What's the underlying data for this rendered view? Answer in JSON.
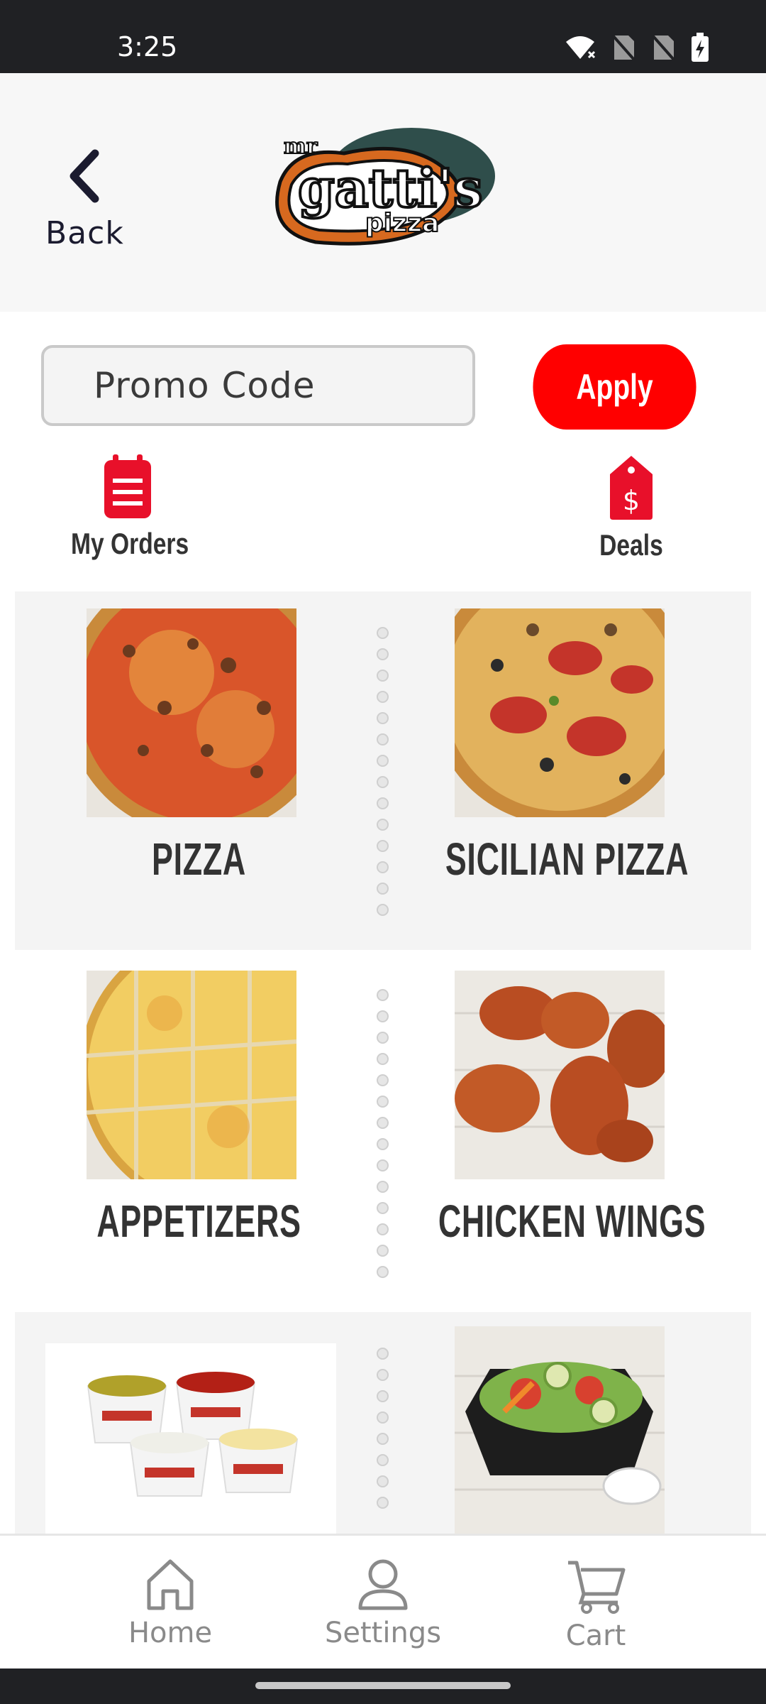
{
  "status": {
    "time": "3:25",
    "icons": [
      "wifi-icon",
      "no-sim-icon",
      "no-sim-icon",
      "battery-charging-icon"
    ]
  },
  "header": {
    "back_label": "Back",
    "logo": {
      "alt": "mr gatti's pizza"
    }
  },
  "promo": {
    "placeholder": "Promo Code",
    "value": "",
    "apply_label": "Apply"
  },
  "quick_actions": [
    {
      "label": "My Orders",
      "icon": "clipboard-icon"
    },
    {
      "label": "Deals",
      "icon": "price-tag-icon"
    }
  ],
  "categories": [
    {
      "title": "PIZZA",
      "image": "pizza-image"
    },
    {
      "title": "SICILIAN PIZZA",
      "image": "sicilian-pizza-image"
    },
    {
      "title": "APPETIZERS",
      "image": "appetizers-image"
    },
    {
      "title": "CHICKEN WINGS",
      "image": "chicken-wings-image"
    },
    {
      "title": "",
      "image": "sauces-image"
    },
    {
      "title": "",
      "image": "salad-image"
    }
  ],
  "nav": [
    {
      "label": "Home",
      "icon": "home-icon"
    },
    {
      "label": "Settings",
      "icon": "user-icon"
    },
    {
      "label": "Cart",
      "icon": "cart-icon"
    }
  ],
  "colors": {
    "accent": "#ff0000",
    "dark": "#1b1b2f",
    "status_bar": "#202124"
  }
}
